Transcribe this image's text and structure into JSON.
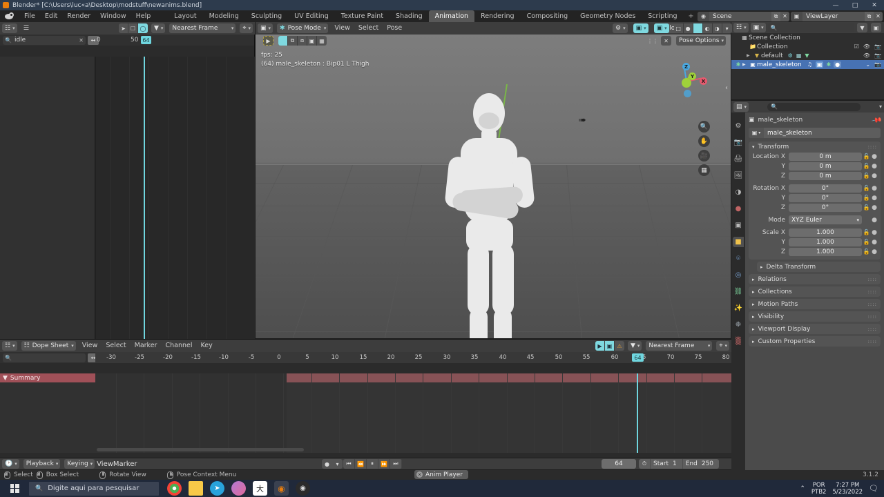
{
  "window": {
    "title": "Blender* [C:\\Users\\luc«a\\Desktop\\modstuff\\newanims.blend]",
    "minimize": "—",
    "maximize": "□",
    "close": "✕"
  },
  "topbar": {
    "menus": [
      "File",
      "Edit",
      "Render",
      "Window",
      "Help"
    ],
    "workspaces": [
      "Layout",
      "Modeling",
      "Sculpting",
      "UV Editing",
      "Texture Paint",
      "Shading",
      "Animation",
      "Rendering",
      "Compositing",
      "Geometry Nodes",
      "Scripting"
    ],
    "active_workspace": "Animation",
    "add_workspace": "+",
    "scene_label": "Scene",
    "viewlayer_label": "ViewLayer",
    "scene_icon": "scene-icon",
    "viewlayer_icon": "viewlayer-icon",
    "new_icon": "⧉",
    "close_icon": "✕"
  },
  "action_editor": {
    "editor_type_icon": "dope-sheet-icon",
    "menu_icon": "☰",
    "search_value": "idle",
    "search_clear": "✕",
    "range_icon": "↔",
    "snap_mode": "Nearest Frame",
    "filter_icon": "filter-icon",
    "proportional_icon": "proportional-edit-icon",
    "ticks": [
      "0",
      "50"
    ],
    "current_frame_badge": "64"
  },
  "viewport": {
    "editor_type_icon": "3d-viewport-icon",
    "mode": "Pose Mode",
    "menus": [
      "View",
      "Select",
      "Pose"
    ],
    "transform_orientation": "Global",
    "snap_icon": "magnet-icon",
    "proportional_icon": "proportional-icon",
    "overlay_fps": "fps: 25",
    "overlay_object": "(64) male_skeleton : Bip01 L Thigh",
    "pose_options": "Pose Options",
    "pose_copy_icon": "copy-pose-icon",
    "pose_x_icon": "✕",
    "gizmo_axes": [
      {
        "label": "X",
        "color": "#e55a6e"
      },
      {
        "label": "Y",
        "color": "#9fd13a"
      },
      {
        "label": "Z",
        "color": "#4aa8e0"
      }
    ],
    "nav_tools": [
      "zoom-icon",
      "hand-icon",
      "camera-icon",
      "grid-icon"
    ],
    "shading_modes": [
      "wireframe-shading",
      "solid-shading",
      "material-shading",
      "rendered-shading"
    ],
    "visibility_icons": [
      "show-gizmo-icon",
      "show-overlays-icon",
      "xray-icon"
    ]
  },
  "outliner": {
    "display_mode_icon": "outliner-display-icon",
    "filter_icon": "filter-icon",
    "new_collection_icon": "new-collection-icon",
    "search_placeholder": "",
    "search_icon": "🔍",
    "rows": [
      {
        "name": "Scene Collection",
        "indent": 0,
        "icon": "scene-collection-icon",
        "selected": false,
        "expand": "",
        "right_icons": [
          "",
          "",
          ""
        ]
      },
      {
        "name": "Collection",
        "indent": 1,
        "icon": "collection-icon",
        "selected": false,
        "expand": "",
        "right_icons": [
          "☑",
          "👁",
          "📷"
        ]
      },
      {
        "name": "default",
        "indent": 1,
        "icon": "mesh-icon",
        "selected": false,
        "expand": "▶",
        "right_icons": [
          "👁",
          "📷"
        ]
      },
      {
        "name": "male_skeleton",
        "indent": 1,
        "icon": "armature-icon",
        "selected": true,
        "expand": "▶",
        "right_icons": [
          "⌄",
          "📷"
        ]
      }
    ]
  },
  "properties": {
    "editor_type_icon": "properties-icon",
    "search_icon": "🔍",
    "search_placeholder": "",
    "breadcrumb_object": "male_skeleton",
    "pin_icon": "pin-icon",
    "object_name": "male_skeleton",
    "tabs": [
      {
        "name": "tool-tab",
        "glyph": "⚙",
        "active": false
      },
      {
        "name": "render-tab",
        "glyph": "📷",
        "active": false
      },
      {
        "name": "output-tab",
        "glyph": "🖨",
        "active": false
      },
      {
        "name": "view-layer-tab",
        "glyph": "🖼",
        "active": false
      },
      {
        "name": "scene-tab",
        "glyph": "◑",
        "active": false
      },
      {
        "name": "world-tab",
        "glyph": "●",
        "active": false
      },
      {
        "name": "collection-tab",
        "glyph": "▣",
        "active": false
      },
      {
        "name": "object-tab",
        "glyph": "■",
        "active": true
      },
      {
        "name": "modifiers-tab",
        "glyph": "⌾",
        "active": false
      },
      {
        "name": "physics-tab",
        "glyph": "◎",
        "active": false
      },
      {
        "name": "object-constraints-tab",
        "glyph": "⛓",
        "active": false
      },
      {
        "name": "object-data-tab",
        "glyph": "✨",
        "active": false
      },
      {
        "name": "bone-tab",
        "glyph": "❉",
        "active": false
      },
      {
        "name": "bone-constraints-tab",
        "glyph": "⛓",
        "active": false
      },
      {
        "name": "texture-tab",
        "glyph": "▒",
        "active": false
      }
    ],
    "transform": {
      "title": "Transform",
      "rows": [
        {
          "label": "Location X",
          "value": "0 m"
        },
        {
          "label": "Y",
          "value": "0 m"
        },
        {
          "label": "Z",
          "value": "0 m"
        },
        {
          "label": "Rotation X",
          "value": "0°"
        },
        {
          "label": "Y",
          "value": "0°"
        },
        {
          "label": "Z",
          "value": "0°"
        }
      ],
      "mode_label": "Mode",
      "mode_value": "XYZ Euler",
      "scale_rows": [
        {
          "label": "Scale X",
          "value": "1.000"
        },
        {
          "label": "Y",
          "value": "1.000"
        },
        {
          "label": "Z",
          "value": "1.000"
        }
      ],
      "lock_icon": "🔓",
      "anim_dot": "●"
    },
    "panels": [
      "Delta Transform",
      "Relations",
      "Collections",
      "Motion Paths",
      "Visibility",
      "Viewport Display",
      "Custom Properties"
    ]
  },
  "dope_sheet": {
    "editor_type_icon": "dope-sheet-icon",
    "mode": "Dope Sheet",
    "menus": [
      "View",
      "Select",
      "Marker",
      "Channel",
      "Key"
    ],
    "search_placeholder": "",
    "search_icon": "🔍",
    "range_icon": "↔",
    "snap_mode": "Nearest Frame",
    "summary_label": "Summary",
    "summary_expand": "▼",
    "ruler_ticks": [
      "-30",
      "-25",
      "-20",
      "-15",
      "-10",
      "-5",
      "0",
      "5",
      "10",
      "15",
      "20",
      "25",
      "30",
      "35",
      "40",
      "45",
      "50",
      "55",
      "60",
      "65",
      "70",
      "75",
      "80"
    ],
    "playhead_frame": "64"
  },
  "timeline": {
    "editor_type_icon": "timeline-icon",
    "menus": [
      "Playback",
      "Keying",
      "View",
      "Marker"
    ],
    "record_icon": "●",
    "transport": [
      "⏮",
      "⏪",
      "⏸",
      "⏩",
      "⏭"
    ],
    "current_frame": "64",
    "use_preview_icon": "⏱",
    "start_label": "Start",
    "start_value": "1",
    "end_label": "End",
    "end_value": "250"
  },
  "status_bar": {
    "items": [
      {
        "icon": "mouse-left-icon",
        "label": "Select"
      },
      {
        "icon": "mouse-box-icon",
        "label": "Box Select"
      },
      {
        "icon": "mouse-middle-icon",
        "label": "Rotate View"
      },
      {
        "icon": "mouse-right-icon",
        "label": "Pose Context Menu"
      }
    ],
    "anim_player": "Anim Player",
    "version": "3.1.2"
  },
  "taskbar": {
    "search_placeholder": "Digite aqui para pesquisar",
    "search_icon": "🔍",
    "apps": [
      "chrome-icon",
      "file-explorer-icon",
      "telegram-icon",
      "paint-icon",
      "winrar-icon",
      "blender-icon",
      "steam-icon"
    ],
    "tray_chevron": "⌃",
    "language": "POR",
    "keyboard": "PTB2",
    "time": "7:27 PM",
    "date": "5/23/2022",
    "notification_icon": "notification-icon"
  }
}
